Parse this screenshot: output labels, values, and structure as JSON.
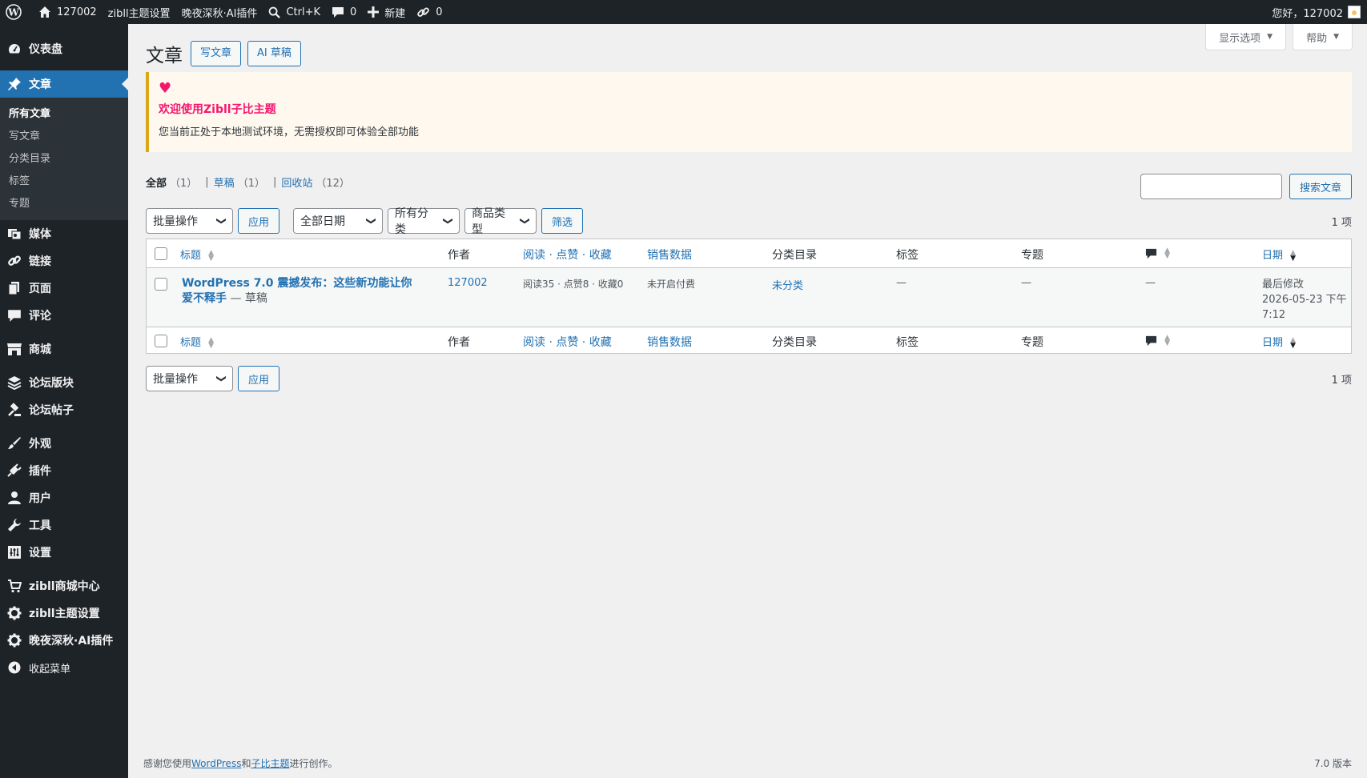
{
  "adminbar": {
    "site_name": "127002",
    "theme_settings": "zibll主题设置",
    "ai_plugin": "晚夜深秋·AI插件",
    "shortcut": "Ctrl+K",
    "comments_count": "0",
    "new_label": "新建",
    "links_count": "0",
    "greeting": "您好，127002"
  },
  "sidebar": {
    "dashboard": "仪表盘",
    "posts": "文章",
    "posts_sub": [
      "所有文章",
      "写文章",
      "分类目录",
      "标签",
      "专题"
    ],
    "media": "媒体",
    "links": "链接",
    "pages": "页面",
    "comments": "评论",
    "shop": "商城",
    "forum_boards": "论坛版块",
    "forum_posts": "论坛帖子",
    "appearance": "外观",
    "plugins": "插件",
    "users": "用户",
    "tools": "工具",
    "settings": "设置",
    "zibll_shop_center": "zibll商城中心",
    "zibll_theme_settings": "zibll主题设置",
    "ai_plugin": "晚夜深秋·AI插件",
    "collapse": "收起菜单"
  },
  "screen_meta": {
    "screen_options": "显示选项",
    "help": "帮助"
  },
  "page": {
    "title": "文章",
    "add_new": "写文章",
    "ai_draft": "AI 草稿"
  },
  "notice": {
    "title": "欢迎使用Zibll子比主题",
    "desc": "您当前正处于本地测试环境，无需授权即可体验全部功能"
  },
  "views": {
    "all_label": "全部",
    "all_count": "（1）",
    "draft_label": "草稿",
    "draft_count": "（1）",
    "trash_label": "回收站",
    "trash_count": "（12）"
  },
  "search": {
    "button": "搜索文章",
    "value": ""
  },
  "tablenav": {
    "bulk_action": "批量操作",
    "apply": "应用",
    "all_dates": "全部日期",
    "all_categories": "所有分类",
    "product_type": "商品类型",
    "filter": "筛选",
    "items_count": "1 项"
  },
  "columns": {
    "title": "标题",
    "author": "作者",
    "stats": "阅读 · 点赞 · 收藏",
    "sales": "销售数据",
    "categories": "分类目录",
    "tags": "标签",
    "topics": "专题",
    "date": "日期"
  },
  "rows": [
    {
      "title": "WordPress 7.0 震撼发布：这些新功能让你爱不释手",
      "state": " — 草稿",
      "author": "127002",
      "stats": "阅读35 · 点赞8 · 收藏0",
      "sales": "未开启付费",
      "category": "未分类",
      "tags": "—",
      "topics": "—",
      "comments": "—",
      "date_label": "最后修改",
      "date_value": "2026-05-23 下午 7:12"
    }
  ],
  "footer": {
    "thanks_prefix": "感谢您使用",
    "wordpress": "WordPress",
    "and": "和",
    "theme": "子比主题",
    "suffix": "进行创作。",
    "version": "7.0 版本"
  }
}
